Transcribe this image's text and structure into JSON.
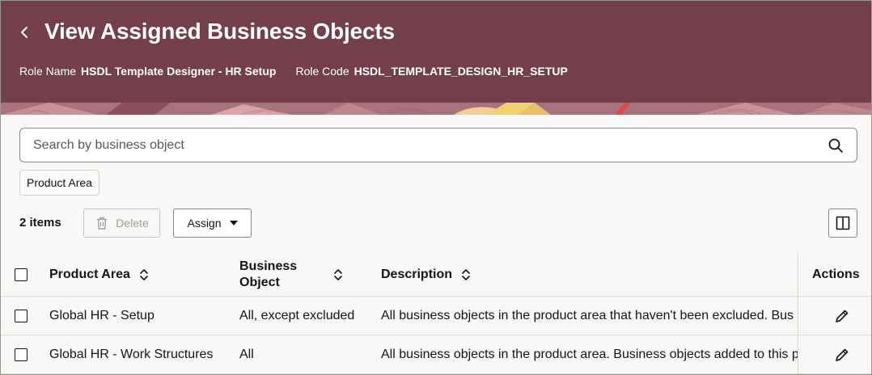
{
  "header": {
    "title": "View Assigned Business Objects",
    "role_name_label": "Role Name",
    "role_name_value": "HSDL Template Designer - HR Setup",
    "role_code_label": "Role Code",
    "role_code_value": "HSDL_TEMPLATE_DESIGN_HR_SETUP",
    "background_color": "#733f4b"
  },
  "search": {
    "placeholder": "Search by business object",
    "value": ""
  },
  "filters": {
    "chip_label": "Product Area"
  },
  "toolbar": {
    "items_count": "2 items",
    "delete_label": "Delete",
    "assign_label": "Assign"
  },
  "table": {
    "columns": {
      "product_area": "Product Area",
      "business_object_line1": "Business",
      "business_object_line2": "Object",
      "description": "Description",
      "actions": "Actions"
    },
    "rows": [
      {
        "product_area": "Global HR - Setup",
        "business_object": "All, except excluded",
        "description": "All business objects in the product area that haven't been excluded. Bus"
      },
      {
        "product_area": "Global HR - Work Structures",
        "business_object": "All",
        "description": "All business objects in the product area. Business objects added to this p"
      }
    ]
  },
  "icons": {
    "back": "chevron-left-icon",
    "search": "search-icon",
    "delete": "trash-icon",
    "assign_caret": "caret-down-icon",
    "columns": "columns-panel-icon",
    "sort": "sort-icon",
    "edit": "pencil-icon"
  }
}
